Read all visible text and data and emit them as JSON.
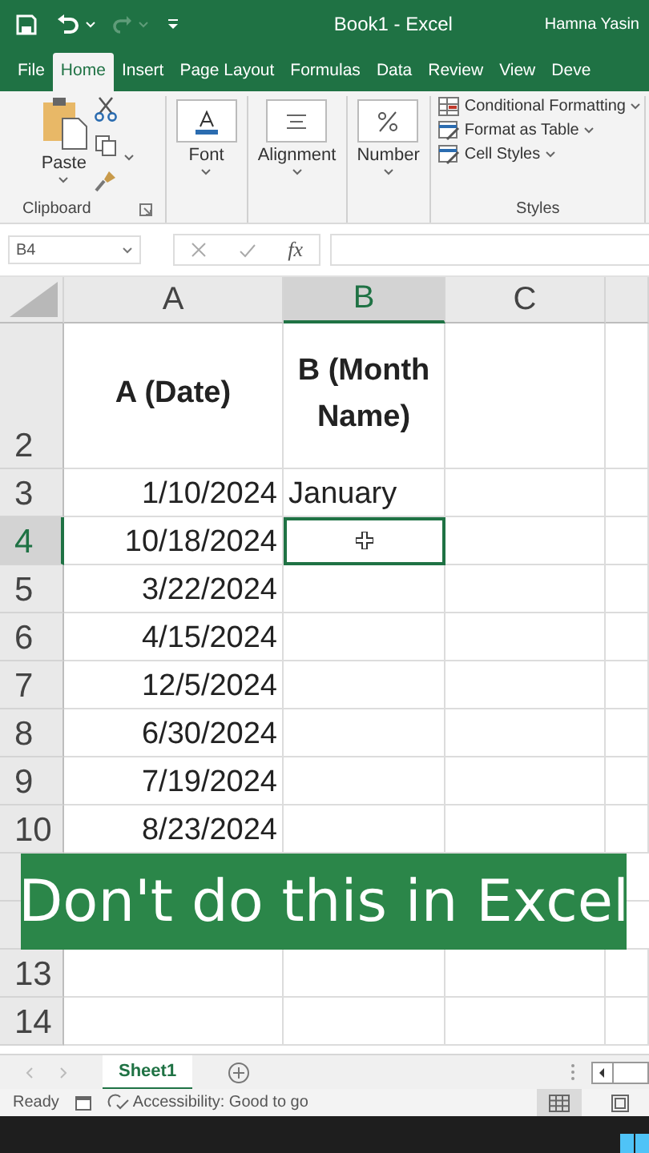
{
  "title_bar": {
    "title": "Book1  -  Excel",
    "user": "Hamna Yasin"
  },
  "ribbon_tabs": [
    {
      "label": "File",
      "selected": false
    },
    {
      "label": "Home",
      "selected": true
    },
    {
      "label": "Insert",
      "selected": false
    },
    {
      "label": "Page Layout",
      "selected": false
    },
    {
      "label": "Formulas",
      "selected": false
    },
    {
      "label": "Data",
      "selected": false
    },
    {
      "label": "Review",
      "selected": false
    },
    {
      "label": "View",
      "selected": false
    },
    {
      "label": "Deve",
      "selected": false
    }
  ],
  "ribbon": {
    "clipboard": {
      "paste": "Paste",
      "group": "Clipboard"
    },
    "groups": [
      "Font",
      "Alignment",
      "Number"
    ],
    "styles": {
      "items": [
        "Conditional Formatting",
        "Format as Table",
        "Cell Styles"
      ],
      "group": "Styles"
    }
  },
  "formula_bar": {
    "name_box": "B4",
    "fx": "fx"
  },
  "sheet": {
    "columns": [
      {
        "label": "A",
        "selected": false
      },
      {
        "label": "B",
        "selected": true
      },
      {
        "label": "C",
        "selected": false
      }
    ],
    "rows": [
      {
        "header": "2",
        "kind": "title",
        "selected": false,
        "a": "A (Date)",
        "b": "B (Month Name)"
      },
      {
        "header": "3",
        "kind": "data",
        "selected": false,
        "a": "1/10/2024",
        "b": "January"
      },
      {
        "header": "4",
        "kind": "data",
        "selected": true,
        "a": "10/18/2024"
      },
      {
        "header": "5",
        "kind": "data",
        "selected": false,
        "a": "3/22/2024"
      },
      {
        "header": "6",
        "kind": "data",
        "selected": false,
        "a": "4/15/2024"
      },
      {
        "header": "7",
        "kind": "data",
        "selected": false,
        "a": "12/5/2024"
      },
      {
        "header": "8",
        "kind": "data",
        "selected": false,
        "a": "6/30/2024"
      },
      {
        "header": "9",
        "kind": "data",
        "selected": false,
        "a": "7/19/2024"
      },
      {
        "header": "10",
        "kind": "data",
        "selected": false,
        "a": "8/23/2024"
      },
      {
        "kind": "data",
        "selected": false
      },
      {
        "kind": "data",
        "selected": false
      },
      {
        "header": "13",
        "kind": "data",
        "selected": false
      },
      {
        "header": "14",
        "kind": "data",
        "selected": false
      }
    ]
  },
  "caption": "Don't do this in Excel",
  "sheet_tabs": [
    {
      "label": "Sheet1",
      "selected": true
    }
  ],
  "status_bar": {
    "mode": "Ready",
    "accessibility": "Accessibility: Good to go"
  }
}
